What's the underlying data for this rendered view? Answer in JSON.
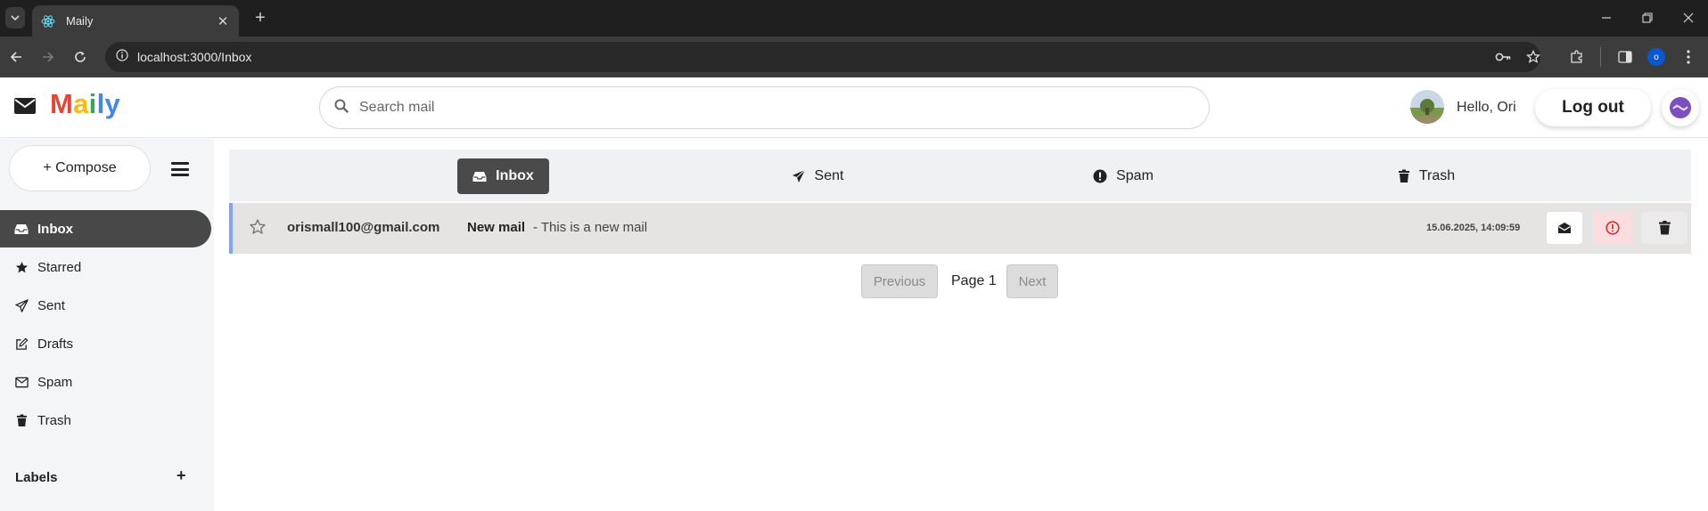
{
  "browser": {
    "tab_title": "Maily",
    "url": "localhost:3000/Inbox",
    "profile_initial": "o"
  },
  "header": {
    "logo_letters": [
      {
        "ch": "M",
        "color": "#ea4335"
      },
      {
        "ch": "a",
        "color": "#fbbc04"
      },
      {
        "ch": "i",
        "color": "#34a853"
      },
      {
        "ch": "l",
        "color": "#4285f4"
      },
      {
        "ch": "y",
        "color": "#4285f4"
      }
    ],
    "search_placeholder": "Search mail",
    "greeting": "Hello, Ori",
    "logout_label": "Log out"
  },
  "sidebar": {
    "compose_label": "+ Compose",
    "items": [
      {
        "label": "Inbox",
        "icon": "inbox-icon",
        "active": true
      },
      {
        "label": "Starred",
        "icon": "star-icon",
        "active": false
      },
      {
        "label": "Sent",
        "icon": "paper-plane-icon",
        "active": false
      },
      {
        "label": "Drafts",
        "icon": "edit-icon",
        "active": false
      },
      {
        "label": "Spam",
        "icon": "envelope-icon",
        "active": false
      },
      {
        "label": "Trash",
        "icon": "trash-icon",
        "active": false
      }
    ],
    "labels_title": "Labels",
    "labels_add": "+"
  },
  "folder_tabs": [
    {
      "label": "Inbox",
      "icon": "inbox-icon",
      "active": true
    },
    {
      "label": "Sent",
      "icon": "paper-plane-icon",
      "active": false
    },
    {
      "label": "Spam",
      "icon": "exclamation-circle-icon",
      "active": false
    },
    {
      "label": "Trash",
      "icon": "trash-icon",
      "active": false
    }
  ],
  "mails": [
    {
      "sender": "orismall100@gmail.com",
      "subject": "New mail",
      "snippet": "- This is a new mail",
      "date": "15.06.2025, 14:09:59",
      "starred": false,
      "unread": true
    }
  ],
  "pagination": {
    "previous_label": "Previous",
    "page_label": "Page 1",
    "next_label": "Next"
  },
  "colors": {
    "accent_dark": "#484848",
    "unread_border": "#7aa7ee",
    "spam_red": "#d93025"
  }
}
